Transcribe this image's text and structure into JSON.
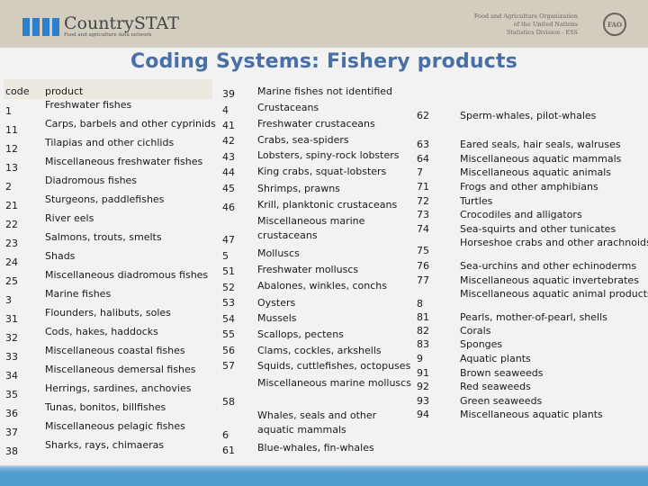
{
  "header": {
    "logo_name": "CountrySTAT",
    "logo_tagline": "Food and agriculture data network",
    "org_line1": "Food and Agriculture Organization",
    "org_line2": "of the United Nations",
    "org_line3": "Statistics Division - ESS",
    "emblem_text": "FAO"
  },
  "title": "Coding Systems: Fishery products",
  "table": {
    "col_code": "code",
    "col_product": "product",
    "col1": [
      {
        "code": "1",
        "product": "Freshwater fishes"
      },
      {
        "code": "11",
        "product": "Carps, barbels and other cyprinids"
      },
      {
        "code": "12",
        "product": "Tilapias and other cichlids"
      },
      {
        "code": "13",
        "product": "Miscellaneous freshwater fishes"
      },
      {
        "code": "2",
        "product": "Diadromous fishes"
      },
      {
        "code": "21",
        "product": "Sturgeons, paddlefishes"
      },
      {
        "code": "22",
        "product": "River eels"
      },
      {
        "code": "23",
        "product": "Salmons, trouts, smelts"
      },
      {
        "code": "24",
        "product": "Shads"
      },
      {
        "code": "25",
        "product": "Miscellaneous diadromous fishes"
      },
      {
        "code": "3",
        "product": "Marine fishes"
      },
      {
        "code": "31",
        "product": "Flounders, halibuts, soles"
      },
      {
        "code": "32",
        "product": "Cods, hakes, haddocks"
      },
      {
        "code": "33",
        "product": "Miscellaneous coastal fishes"
      },
      {
        "code": "34",
        "product": "Miscellaneous demersal fishes"
      },
      {
        "code": "35",
        "product": "Herrings, sardines, anchovies"
      },
      {
        "code": "36",
        "product": "Tunas, bonitos, billfishes"
      },
      {
        "code": "37",
        "product": "Miscellaneous pelagic fishes"
      },
      {
        "code": "38",
        "product": "Sharks, rays, chimaeras"
      }
    ],
    "col2_codes": [
      "39",
      "4",
      "41",
      "42",
      "43",
      "44",
      "45",
      "46",
      "47",
      "5",
      "51",
      "52",
      "53",
      "54",
      "55",
      "56",
      "57",
      "58",
      "6",
      "61"
    ],
    "col2_products": [
      "Marine fishes not identified",
      "Crustaceans",
      "Freshwater crustaceans",
      "Crabs, sea-spiders",
      "Lobsters, spiny-rock lobsters",
      "King crabs, squat-lobsters",
      "Shrimps, prawns",
      "Krill, planktonic crustaceans",
      "Miscellaneous marine",
      "crustaceans",
      "Molluscs",
      "Freshwater molluscs",
      "Abalones, winkles, conchs",
      "Oysters",
      "Mussels",
      "Scallops, pectens",
      "Clams, cockles, arkshells",
      "Squids, cuttlefishes, octopuses",
      "Miscellaneous marine molluscs",
      "Whales, seals and other",
      "aquatic mammals",
      "Blue-whales, fin-whales"
    ],
    "col3_codes": [
      "62",
      "63",
      "64",
      "7",
      "71",
      "72",
      "73",
      "74",
      "75",
      "76",
      "77",
      "8",
      "81",
      "82",
      "83",
      "9",
      "91",
      "92",
      "93",
      "94"
    ],
    "col3_products": [
      "Sperm-whales, pilot-whales",
      "Eared seals, hair seals, walruses",
      "Miscellaneous aquatic mammals",
      "Miscellaneous aquatic animals",
      "Frogs and other amphibians",
      "Turtles",
      "Crocodiles and alligators",
      "Sea-squirts and other tunicates",
      "Horseshoe crabs and other arachnoids",
      "Sea-urchins and other echinoderms",
      "Miscellaneous aquatic invertebrates",
      "Miscellaneous aquatic animal products",
      "Pearls, mother-of-pearl, shells",
      "Corals",
      "Sponges",
      "Aquatic plants",
      "Brown seaweeds",
      "Red seaweeds",
      "Green seaweeds",
      "Miscellaneous aquatic plants"
    ]
  }
}
